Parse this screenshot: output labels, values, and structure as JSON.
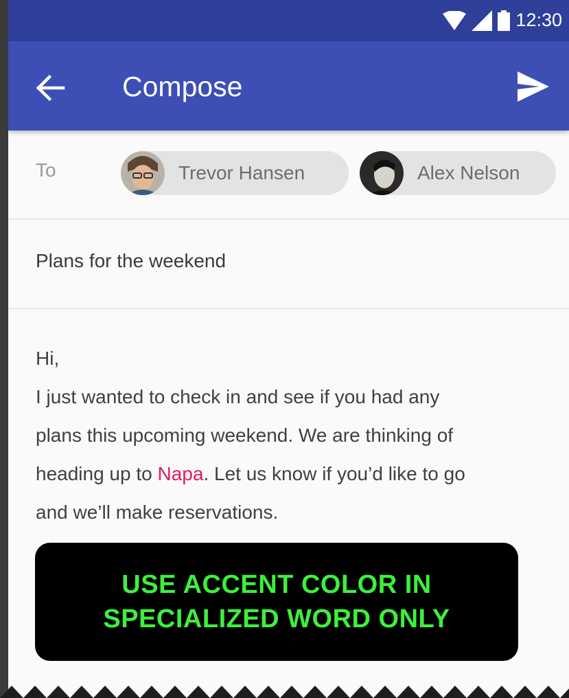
{
  "status_bar": {
    "time": "12:30",
    "icons": [
      "wifi-icon",
      "signal-icon",
      "battery-icon"
    ]
  },
  "app_bar": {
    "title": "Compose",
    "back_icon": "arrow-left-icon",
    "send_icon": "send-icon"
  },
  "compose": {
    "to_label": "To",
    "recipients": [
      {
        "name": "Trevor Hansen",
        "avatar": "avatar-photo"
      },
      {
        "name": "Alex Nelson",
        "avatar": "avatar-photo"
      }
    ],
    "subject": "Plans for the weekend",
    "body": {
      "greeting": "Hi,",
      "line1": "I just wanted to check in and see if you had any",
      "line2": "plans this upcoming weekend. We are thinking of",
      "line3_before": "heading up to ",
      "line3_accent": "Napa",
      "line3_after": ". Let us know if you’d like to go",
      "line4": "and we’ll make reservations."
    }
  },
  "banner": {
    "line1": "USE ACCENT COLOR IN",
    "line2": "SPECIALIZED WORD ONLY"
  },
  "colors": {
    "primary": "#3d4fb5",
    "primary_dark": "#2f3f9a",
    "accent": "#e6195a",
    "banner_text": "#3cf03c"
  }
}
